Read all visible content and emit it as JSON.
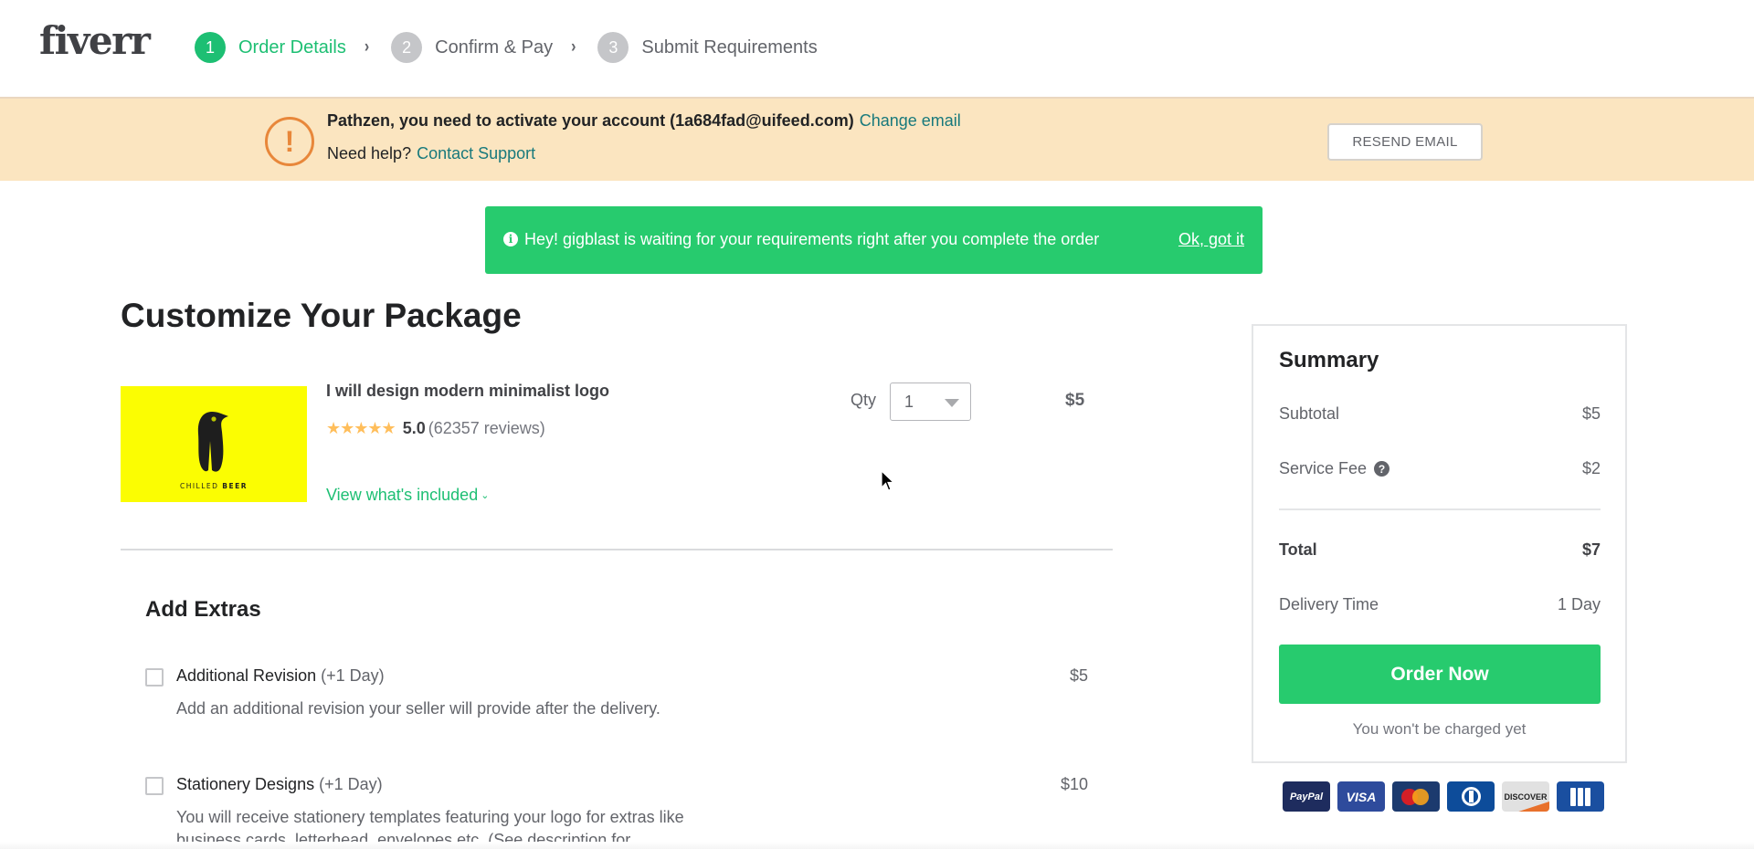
{
  "header": {
    "logo": "fiverr",
    "steps": [
      {
        "number": "1",
        "label": "Order Details",
        "active": true
      },
      {
        "number": "2",
        "label": "Confirm & Pay",
        "active": false
      },
      {
        "number": "3",
        "label": "Submit Requirements",
        "active": false
      }
    ],
    "step_separator": "›"
  },
  "activation_banner": {
    "icon": "exclamation-circle-icon",
    "icon_glyph": "!",
    "message": "Pathzen, you need to activate your account (1a684fad@uifeed.com)",
    "change_email_link": "Change email",
    "help_prefix": "Need help?",
    "contact_support_link": "Contact Support",
    "resend_button": "RESEND EMAIL"
  },
  "notice": {
    "icon": "info-icon",
    "icon_glyph": "i",
    "message": "Hey! gigblast is waiting for your requirements right after you complete the order",
    "dismiss_link": "Ok, got it"
  },
  "package": {
    "title": "Customize Your Package",
    "gig": {
      "thumbnail_text_light": "CHILLED ",
      "thumbnail_text_bold": "BEER",
      "title": "I will design modern minimalist logo",
      "stars": "★★★★★",
      "rating": "5.0",
      "reviews": "(62357 reviews)",
      "view_included": "View what's included",
      "view_included_chevron": "⌄"
    },
    "quantity": {
      "label": "Qty",
      "value": "1"
    },
    "price": "$5"
  },
  "extras": {
    "title": "Add Extras",
    "items": [
      {
        "name": "Additional Revision",
        "meta": " (+1 Day)",
        "description": "Add an additional revision your seller will provide after the delivery.",
        "price": "$5",
        "checked": false
      },
      {
        "name": "Stationery Designs",
        "meta": " (+1 Day)",
        "description": "You will receive stationery templates featuring your logo for extras like business cards, letterhead, envelopes etc. (See description for",
        "price": "$10",
        "checked": false
      }
    ]
  },
  "summary": {
    "title": "Summary",
    "subtotal_label": "Subtotal",
    "subtotal_value": "$5",
    "service_fee_label": "Service Fee",
    "service_fee_help_glyph": "?",
    "service_fee_value": "$2",
    "total_label": "Total",
    "total_value": "$7",
    "delivery_label": "Delivery Time",
    "delivery_value": "1 Day",
    "order_button": "Order Now",
    "charge_note": "You won't be charged yet"
  },
  "payment_methods": [
    {
      "name": "PayPal",
      "label": "PayPal"
    },
    {
      "name": "Visa",
      "label": "VISA"
    },
    {
      "name": "MasterCard",
      "label": ""
    },
    {
      "name": "Diners Club",
      "label": ""
    },
    {
      "name": "Discover",
      "label": "DISCOVER"
    },
    {
      "name": "JCB",
      "label": ""
    }
  ],
  "colors": {
    "brand_green": "#1dbf73",
    "button_green": "#27cb6e",
    "banner_bg": "#fbe5c0",
    "warning_orange": "#e8873a",
    "link_teal": "#18797c",
    "star_yellow": "#ffbe5b"
  }
}
